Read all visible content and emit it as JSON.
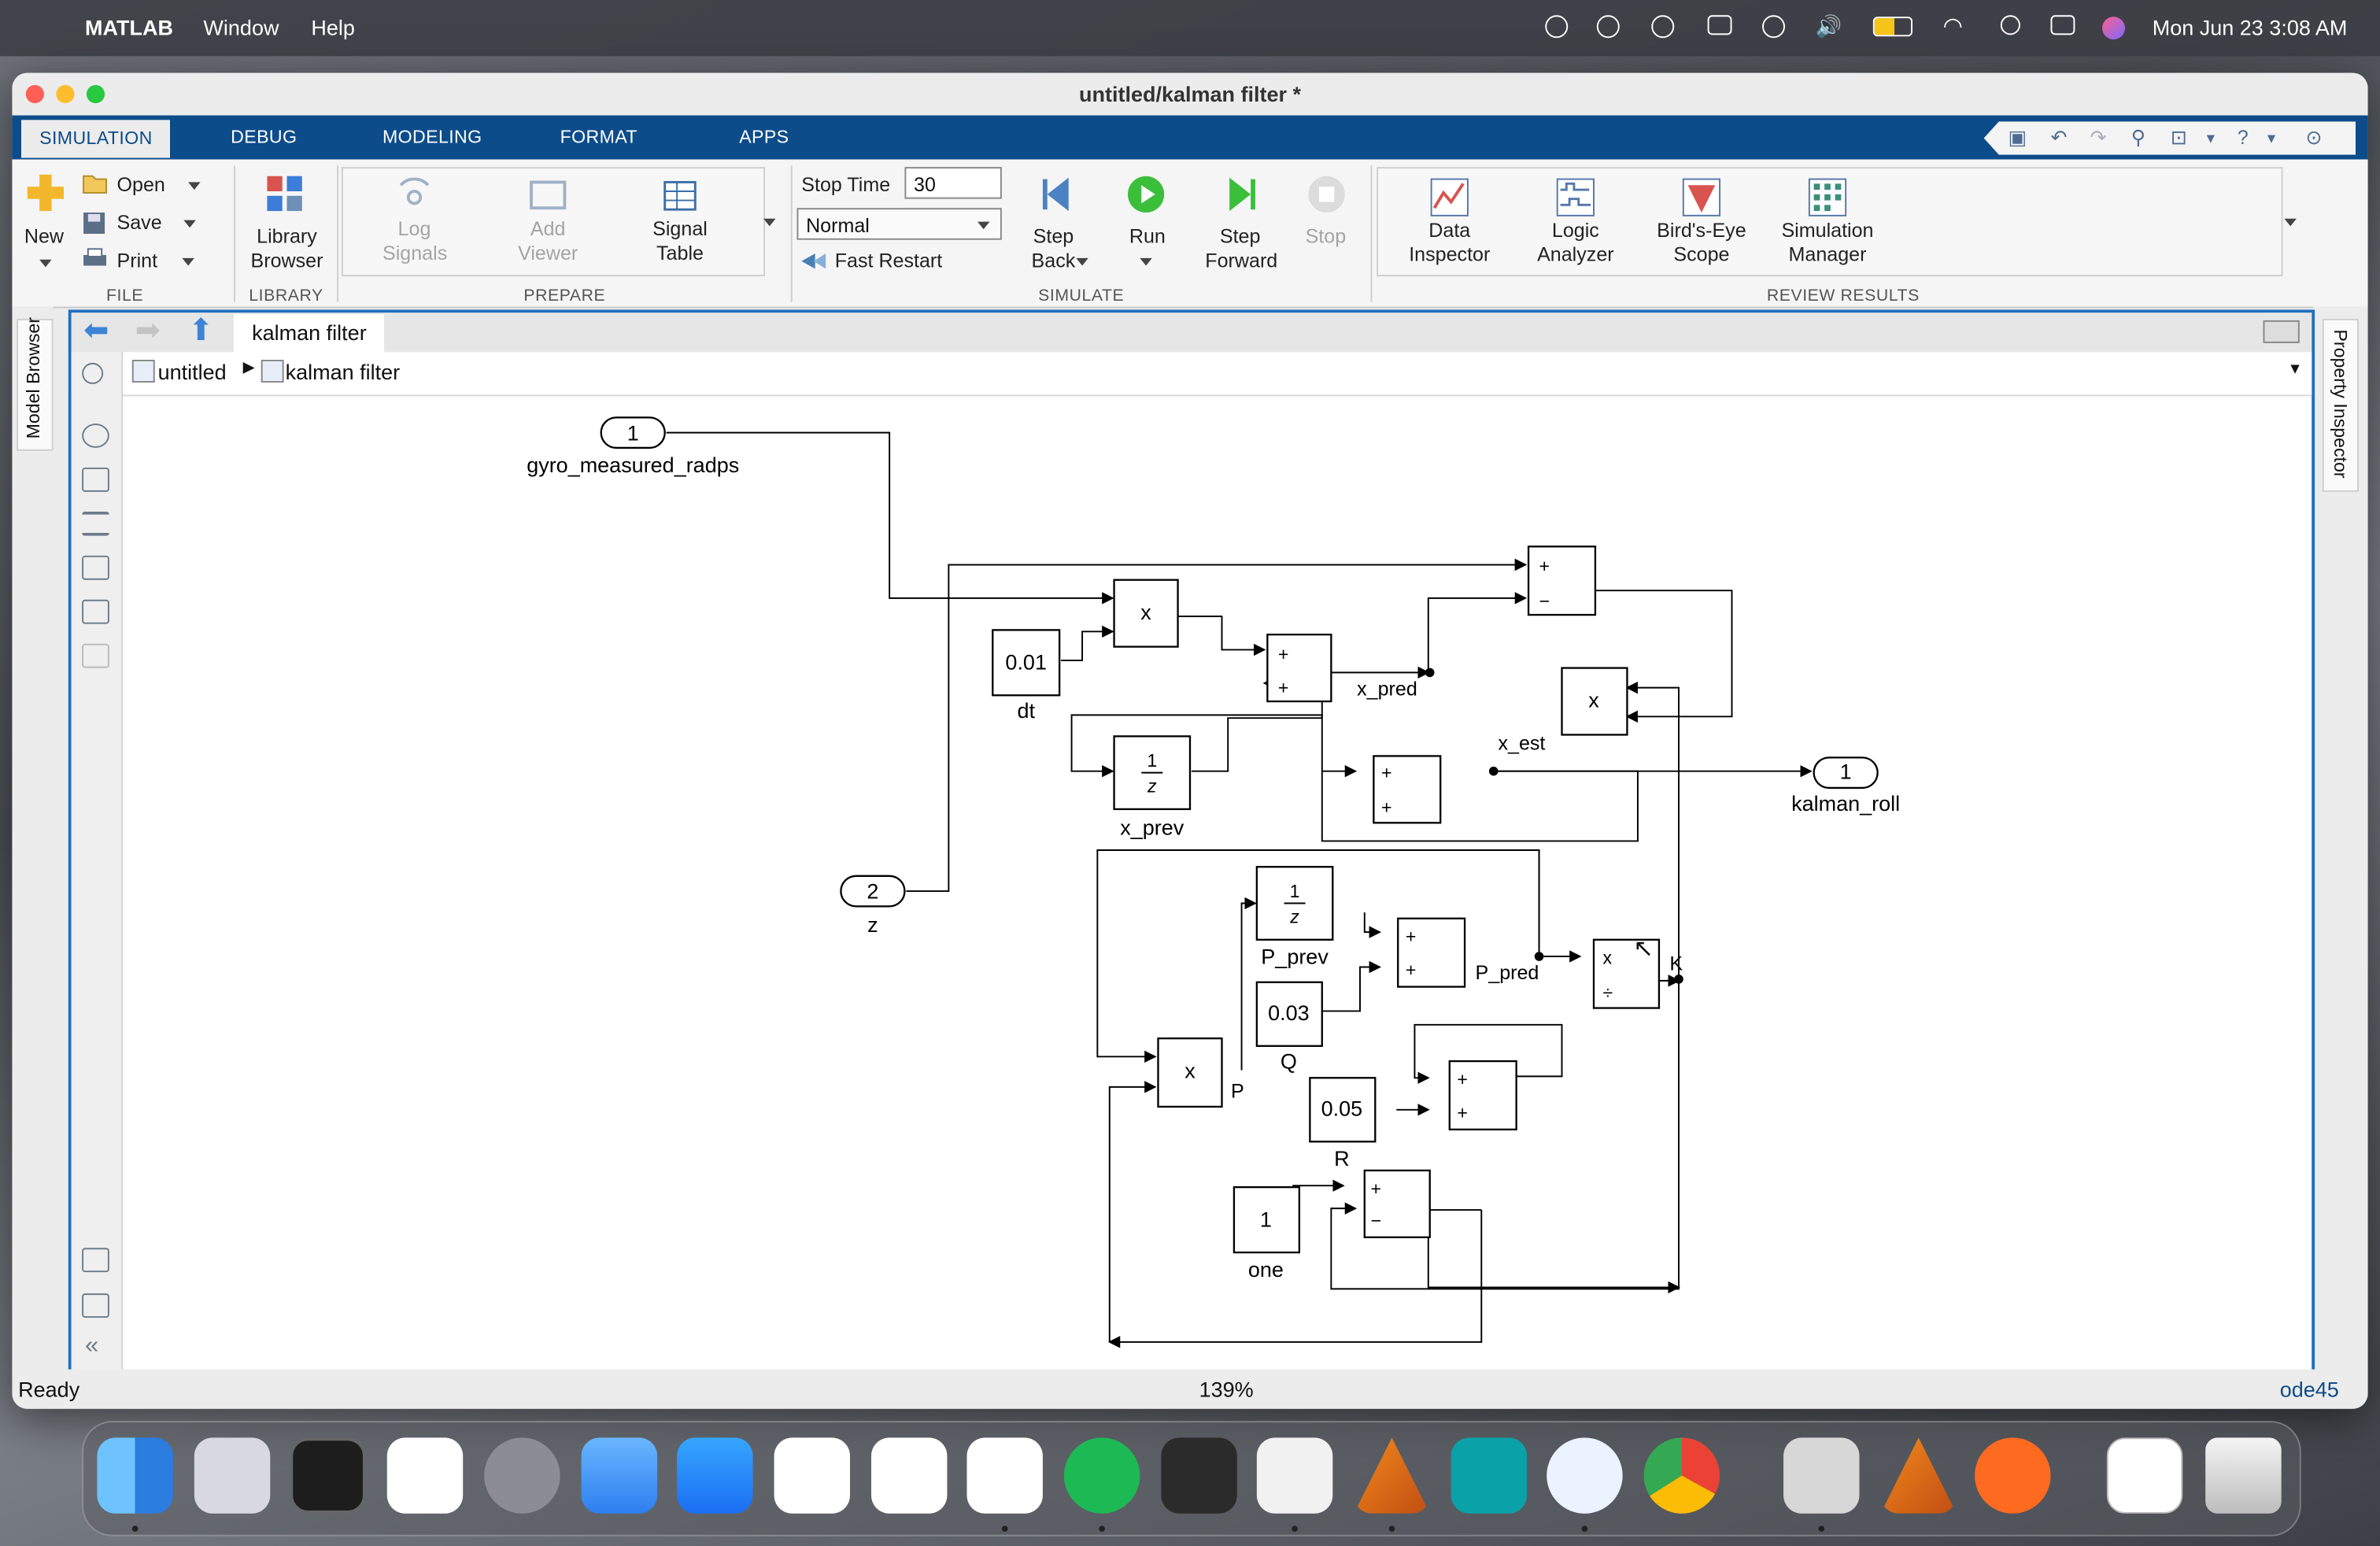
{
  "menubar": {
    "app": "MATLAB",
    "menus": [
      "Window",
      "Help"
    ],
    "datetime": "Mon Jun 23  3:08 AM"
  },
  "window": {
    "title": "untitled/kalman filter *",
    "tabs": [
      "SIMULATION",
      "DEBUG",
      "MODELING",
      "FORMAT",
      "APPS"
    ]
  },
  "ribbon": {
    "file": {
      "new": "New",
      "open": "Open",
      "save": "Save",
      "print": "Print",
      "section": "FILE"
    },
    "library": {
      "browser": "Library\nBrowser",
      "section": "LIBRARY"
    },
    "prepare": {
      "log": "Log\nSignals",
      "viewer": "Add\nViewer",
      "table": "Signal\nTable",
      "section": "PREPARE"
    },
    "simulate": {
      "stop_time_label": "Stop Time",
      "stop_time_value": "30",
      "mode": "Normal",
      "fast_restart": "Fast Restart",
      "step_back": "Step\nBack",
      "run": "Run",
      "step_forward": "Step\nForward",
      "stop": "Stop",
      "section": "SIMULATE"
    },
    "review": {
      "data_inspector": "Data\nInspector",
      "logic_analyzer": "Logic\nAnalyzer",
      "birds_eye": "Bird's-Eye\nScope",
      "sim_manager": "Simulation\nManager",
      "section": "REVIEW RESULTS"
    }
  },
  "side": {
    "model_browser": "Model Browser",
    "property_inspector": "Property Inspector"
  },
  "editor": {
    "tab": "kalman filter",
    "breadcrumb": [
      "untitled",
      "kalman filter"
    ]
  },
  "diagram": {
    "in1": {
      "num": "1",
      "name": "gyro_measured_radps"
    },
    "in2": {
      "num": "2",
      "name": "z"
    },
    "out1": {
      "num": "1",
      "name": "kalman_roll"
    },
    "dt": {
      "value": "0.01",
      "name": "dt"
    },
    "Q": {
      "value": "0.03",
      "name": "Q"
    },
    "R": {
      "value": "0.05",
      "name": "R"
    },
    "one": {
      "value": "1",
      "name": "one"
    },
    "x_prev": {
      "name": "x_prev",
      "num": "1",
      "den": "z"
    },
    "P_prev": {
      "name": "P_prev",
      "num": "1",
      "den": "z"
    },
    "product": "x",
    "divide": "÷",
    "plus": "+",
    "minus": "−",
    "signals": {
      "x_pred": "x_pred",
      "x_est": "x_est",
      "P_pred": "P_pred",
      "K": "K",
      "P": "P"
    }
  },
  "status": {
    "left": "Ready",
    "zoom": "139%",
    "solver": "ode45"
  }
}
